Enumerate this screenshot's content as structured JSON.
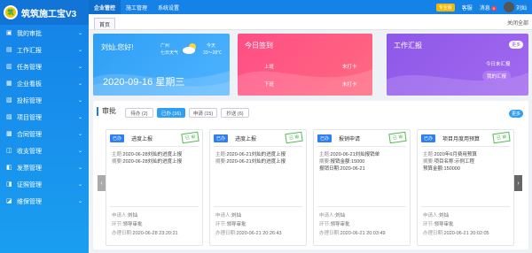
{
  "app": {
    "logo_mark": "筑",
    "title": "筑筑施工宝V3"
  },
  "sidebar": {
    "items": [
      {
        "label": "我的审批",
        "icon": "approval-icon",
        "expandable": true
      },
      {
        "label": "工作汇报",
        "icon": "report-icon",
        "expandable": true
      },
      {
        "label": "任务管理",
        "icon": "task-icon",
        "expandable": true
      },
      {
        "label": "企业看板",
        "icon": "dashboard-icon",
        "expandable": true
      },
      {
        "label": "投标管理",
        "icon": "bid-icon",
        "expandable": true
      },
      {
        "label": "项目管理",
        "icon": "project-icon",
        "expandable": true
      },
      {
        "label": "合同管理",
        "icon": "contract-icon",
        "expandable": true
      },
      {
        "label": "收支管理",
        "icon": "finance-icon",
        "expandable": true
      },
      {
        "label": "发票管理",
        "icon": "invoice-icon",
        "expandable": true
      },
      {
        "label": "证照管理",
        "icon": "license-icon",
        "expandable": true
      },
      {
        "label": "维保管理",
        "icon": "maintenance-icon",
        "expandable": true
      }
    ]
  },
  "topbar": {
    "nav": [
      "企业管控",
      "施工管理",
      "系统设置"
    ],
    "pro_badge": "专业版",
    "service": "客服",
    "messages": "消息",
    "message_count": "9",
    "user": "刘灿"
  },
  "tabs": {
    "home": "首页",
    "close_others": "关闭全部"
  },
  "welcome_card": {
    "greeting": "刘灿,您好!",
    "city": "广州",
    "weather": "七日天气",
    "today_label": "今天",
    "temperature": "33～28℃",
    "date": "2020-09-16 星期三"
  },
  "checkin_card": {
    "title": "今日签到",
    "morning_label": "上班",
    "morning_status": "未打卡",
    "evening_label": "下班",
    "evening_status": "未打卡"
  },
  "report_card": {
    "title": "工作汇报",
    "more": "更多",
    "today_status": "今日未汇报",
    "action_button": "我的汇报"
  },
  "approval": {
    "title": "审批",
    "tabs": [
      {
        "label": "待办 (2)",
        "active": false
      },
      {
        "label": "已办 (16)",
        "active": true
      },
      {
        "label": "申请 (15)",
        "active": false
      },
      {
        "label": "抄送 (6)",
        "active": false
      }
    ],
    "more": "更多",
    "field_labels": {
      "applicant": "申请人:",
      "step": "环节:",
      "date": "办理日期:"
    },
    "cards": [
      {
        "tag": "已办",
        "title": "进度上报",
        "stamp": "已 审",
        "lines": [
          {
            "k": "主题:",
            "v": "2020-06-28刘灿的进度上报"
          },
          {
            "k": "摘要:",
            "v": "2020-06-28刘灿的进度上报"
          }
        ],
        "applicant": "刘灿",
        "step": "领导审批",
        "date": "2020-06-28 23:20:21"
      },
      {
        "tag": "已办",
        "title": "进度上报",
        "stamp": "已 审",
        "lines": [
          {
            "k": "主题:",
            "v": "2020-06-21刘灿的进度上报"
          },
          {
            "k": "摘要:",
            "v": "2020-06-21刘灿的进度上报"
          }
        ],
        "applicant": "刘灿",
        "step": "领导审批",
        "date": "2020-06-21 20:26:43"
      },
      {
        "tag": "已办",
        "title": "报销申请",
        "stamp": "已 审",
        "lines": [
          {
            "k": "主题:",
            "v": "2020-06-21刘灿报销单"
          },
          {
            "k": "摘要:",
            "v": "报销金额:15000"
          },
          {
            "k": "",
            "v": "报销日期:2020-06-21"
          }
        ],
        "applicant": "刘灿",
        "step": "领导审批",
        "date": "2020-06-21 20:03:49"
      },
      {
        "tag": "已办",
        "title": "项目月度用预算",
        "stamp": "已 审",
        "lines": [
          {
            "k": "主题:",
            "v": "2020年6月费用预算"
          },
          {
            "k": "摘要:",
            "v": "项目名称:示例工程"
          },
          {
            "k": "",
            "v": "预算金额:150000"
          }
        ],
        "applicant": "刘灿",
        "step": "领导审批",
        "date": "2020-06-21 20:02:05"
      }
    ]
  },
  "colors": {
    "primary": "#1582e8",
    "pink": "#ff4d86",
    "purple": "#8e57e8",
    "stamp_green": "#55bb55"
  }
}
